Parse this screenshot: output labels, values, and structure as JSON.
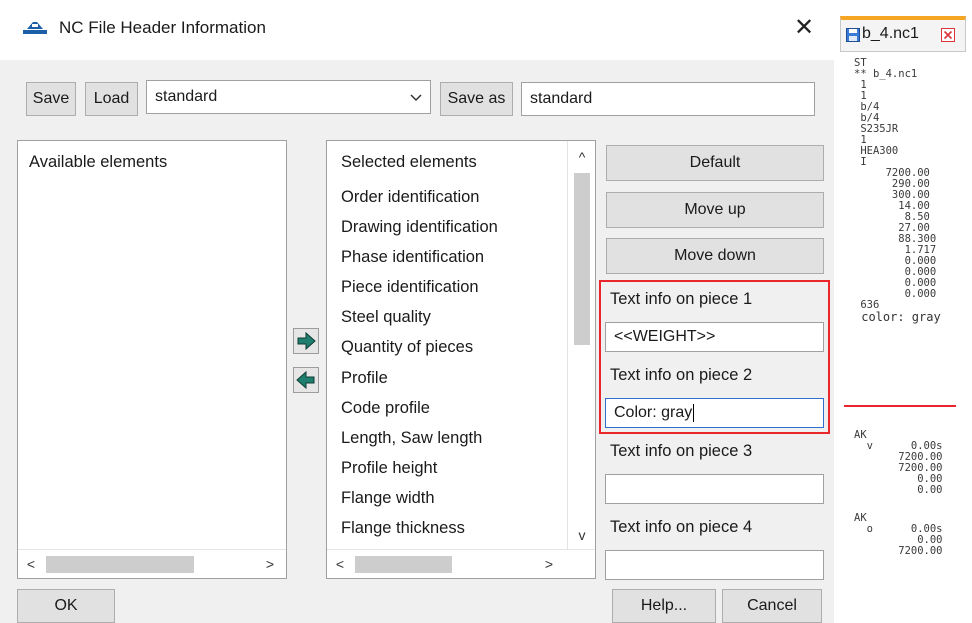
{
  "dialog": {
    "title": "NC File Header Information",
    "close": "✕"
  },
  "toolbar": {
    "save_label": "Save",
    "load_label": "Load",
    "preset_value": "standard",
    "save_as_label": "Save as",
    "save_as_value": "standard"
  },
  "available": {
    "title": "Available elements"
  },
  "selected": {
    "title": "Selected elements",
    "items": [
      "Order identification",
      "Drawing identification",
      "Phase identification",
      "Piece identification",
      "Steel quality",
      "Quantity of pieces",
      "Profile",
      "Code profile",
      "Length, Saw length",
      "Profile height",
      "Flange width",
      "Flange thickness"
    ]
  },
  "actions": {
    "default_label": "Default",
    "move_up_label": "Move up",
    "move_down_label": "Move down"
  },
  "text_info": [
    {
      "label": "Text info on piece 1",
      "value": "<<WEIGHT>>"
    },
    {
      "label": "Text info on piece 2",
      "value": "Color: gray"
    },
    {
      "label": "Text info on piece 3",
      "value": ""
    },
    {
      "label": "Text info on piece 4",
      "value": ""
    }
  ],
  "footer": {
    "ok_label": "OK",
    "help_label": "Help...",
    "cancel_label": "Cancel"
  },
  "editor": {
    "tab_label": "b_4.nc1",
    "lines_top": "ST\n** b_4.nc1\n 1\n 1\n b/4\n b/4\n S235JR\n 1\n HEA300\n I\n     7200.00\n      290.00\n      300.00\n       14.00\n        8.50\n       27.00\n       88.300\n        1.717\n        0.000\n        0.000\n        0.000\n        0.000\n 636",
    "color_line": " color: gray",
    "lines_ak1": "AK\n  v      0.00s\n       7200.00\n       7200.00\n          0.00\n          0.00",
    "lines_ak2": "AK\n  o      0.00s\n          0.00\n       7200.00"
  },
  "colors": {
    "highlight_border": "#e8262b",
    "tab_accent": "#f5a623",
    "tab_close": "#d9363e"
  }
}
